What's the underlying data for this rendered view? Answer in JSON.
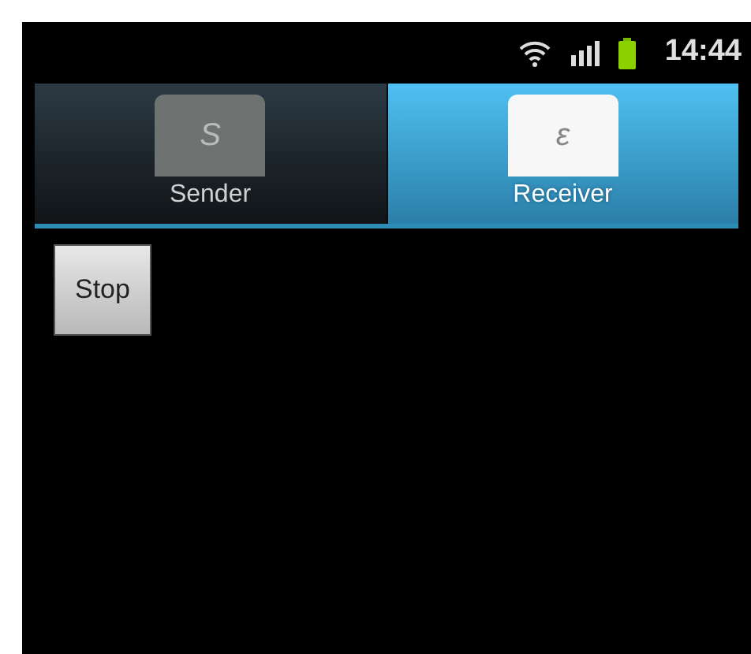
{
  "status_bar": {
    "time": "14:44"
  },
  "tabs": [
    {
      "label": "Sender",
      "icon_glyph": "S",
      "selected": false
    },
    {
      "label": "Receiver",
      "icon_glyph": "ε",
      "selected": true
    }
  ],
  "buttons": [
    "Stop"
  ]
}
